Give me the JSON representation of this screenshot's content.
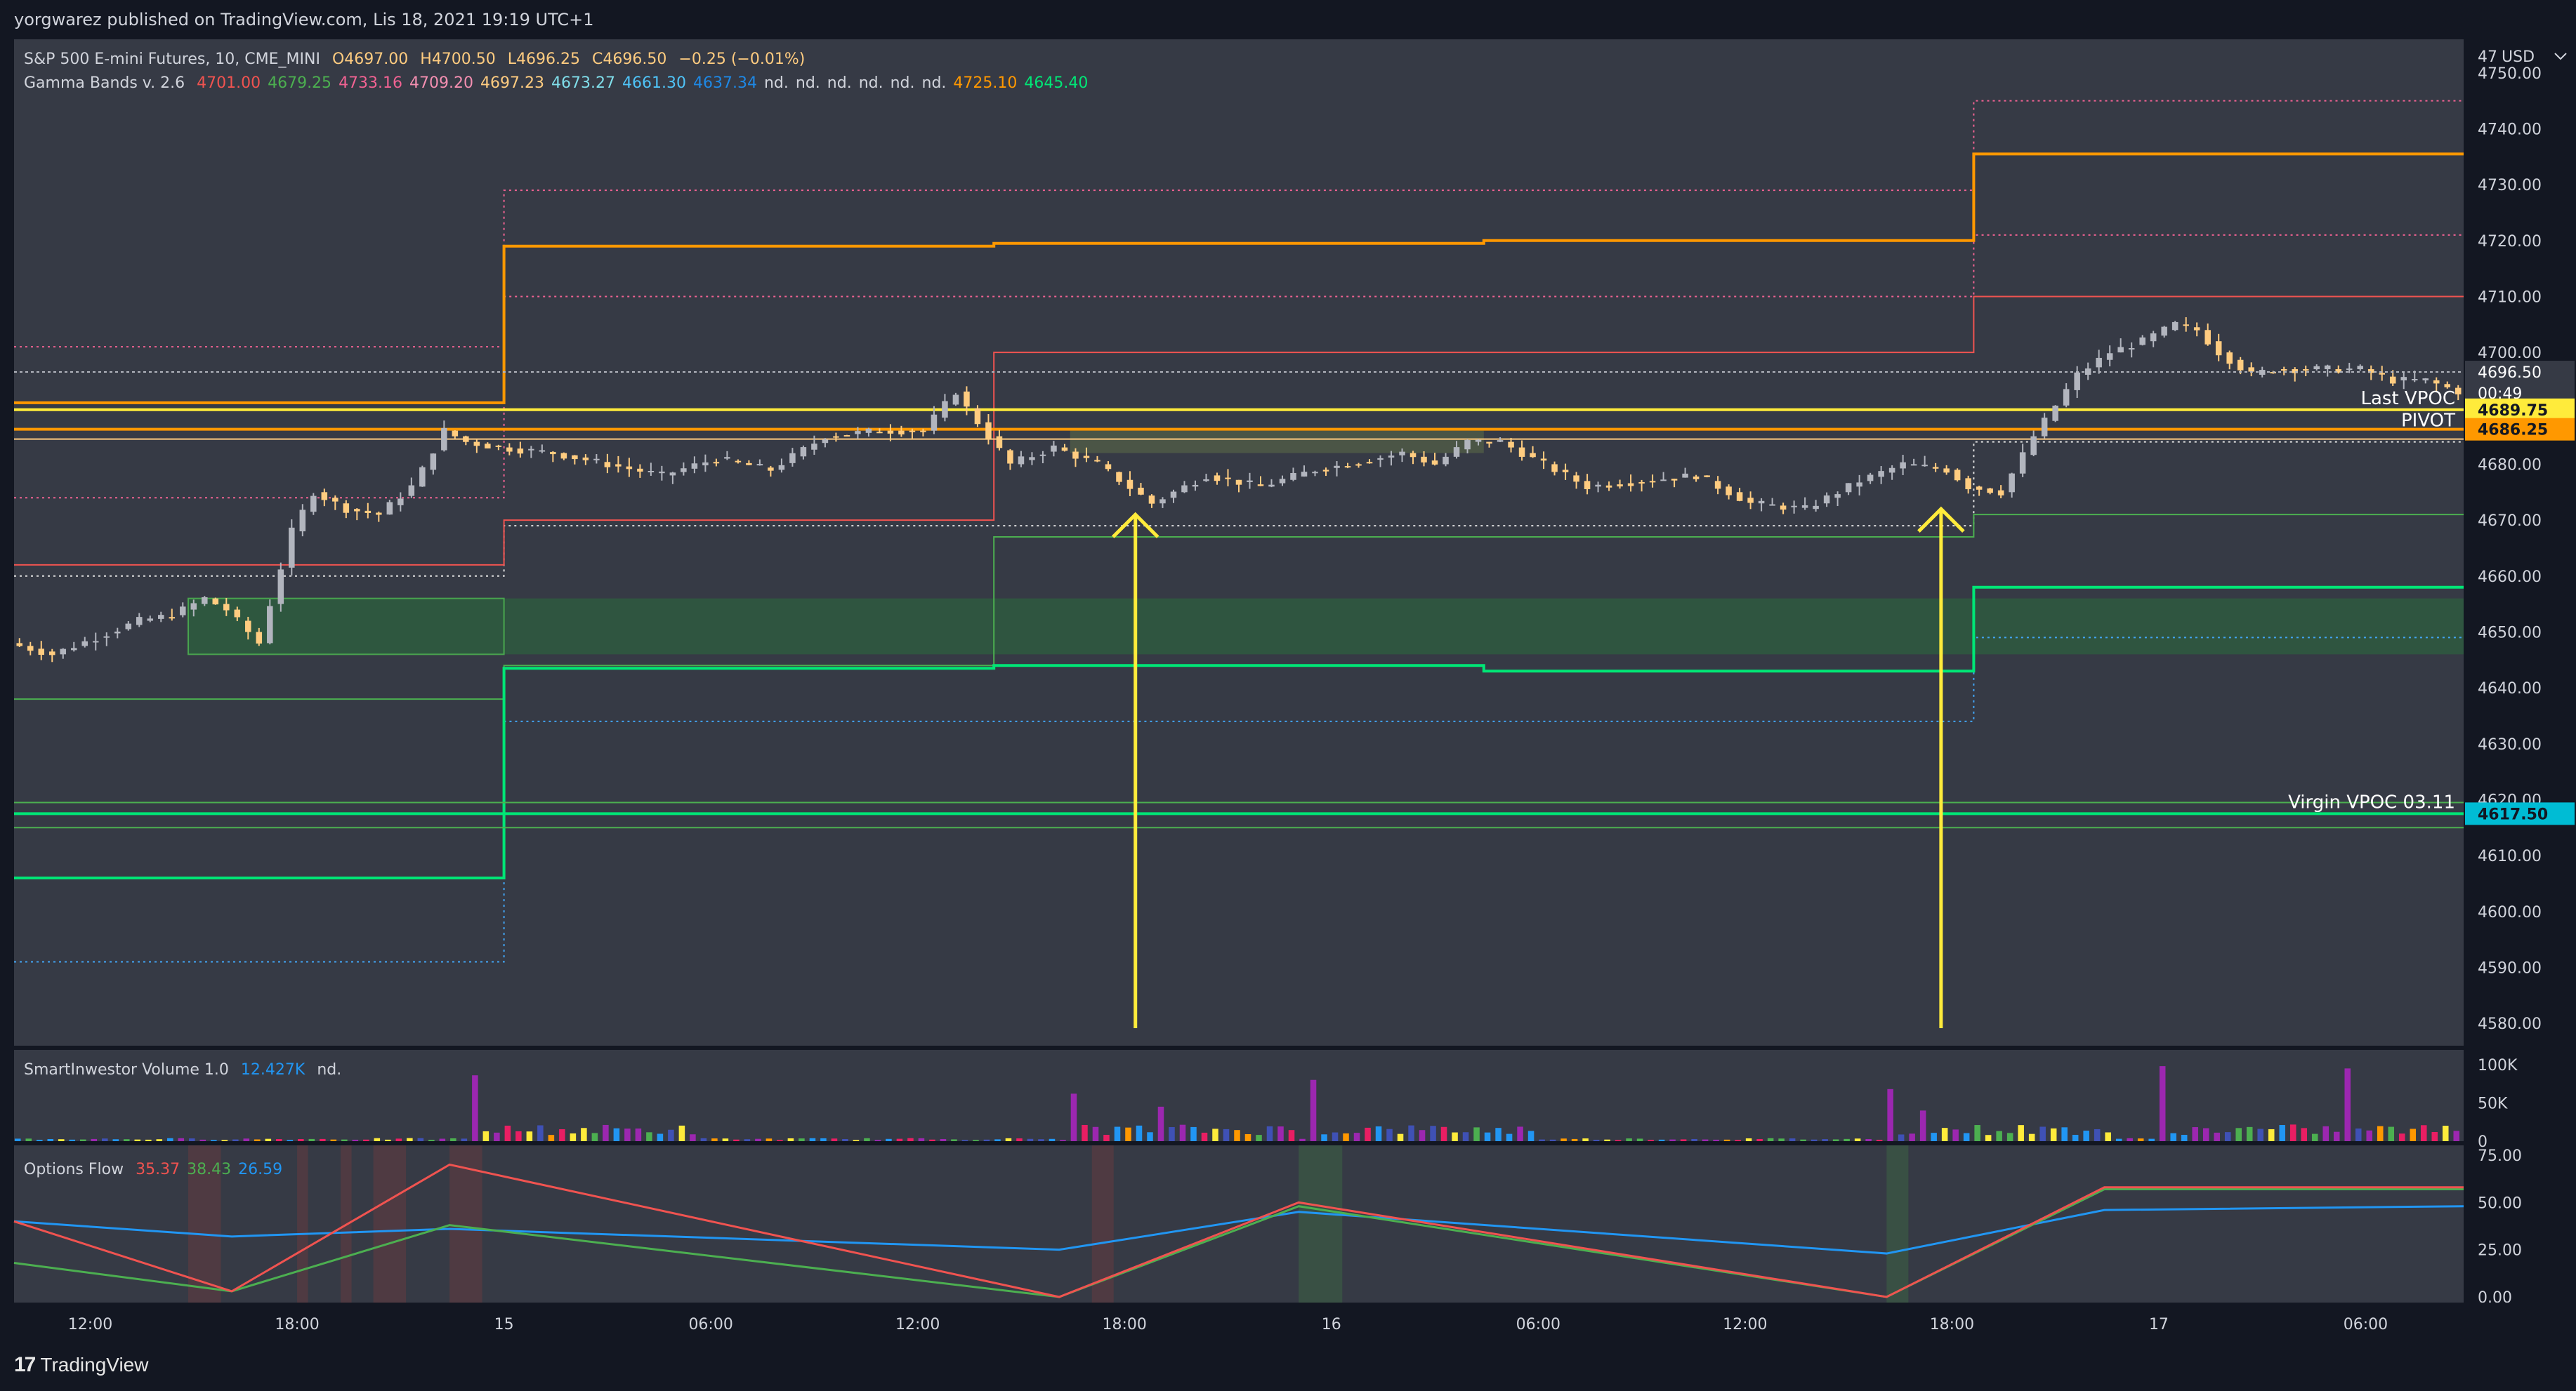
{
  "header": {
    "publisher_line": "yorgwarez published on TradingView.com, Lis 18, 2021 19:19 UTC+1"
  },
  "footer": {
    "logo_mark": "17",
    "logo_text": "TradingView"
  },
  "price_pane": {
    "symbol": "S&P 500 E-mini Futures, 10, CME_MINI",
    "ohlc": {
      "o_label": "O",
      "o": "4697.00",
      "h_label": "H",
      "h": "4700.50",
      "l_label": "L",
      "l": "4696.25",
      "c_label": "C",
      "c": "4696.50",
      "change": "−0.25 (−0.01%)"
    },
    "indicator": {
      "name": "Gamma Bands v. 2.6",
      "values": [
        {
          "text": "4701.00",
          "color": "#f05350"
        },
        {
          "text": "4679.25",
          "color": "#4caf50"
        },
        {
          "text": "4733.16",
          "color": "#f06292"
        },
        {
          "text": "4709.20",
          "color": "#f48fb1"
        },
        {
          "text": "4697.23",
          "color": "#ffcc80"
        },
        {
          "text": "4673.27",
          "color": "#80deea"
        },
        {
          "text": "4661.30",
          "color": "#4fc3f7"
        },
        {
          "text": "4637.34",
          "color": "#1e88e5"
        },
        {
          "text": "nd.",
          "color": "#d1d4dc"
        },
        {
          "text": "nd.",
          "color": "#d1d4dc"
        },
        {
          "text": "nd.",
          "color": "#d1d4dc"
        },
        {
          "text": "nd.",
          "color": "#d1d4dc"
        },
        {
          "text": "nd.",
          "color": "#d1d4dc"
        },
        {
          "text": "nd.",
          "color": "#d1d4dc"
        },
        {
          "text": "4725.10",
          "color": "#ff9800"
        },
        {
          "text": "4645.40",
          "color": "#00e676"
        }
      ]
    },
    "axis_currency": "USD",
    "price_labels": [
      "4750.00",
      "4740.00",
      "4730.00",
      "4720.00",
      "4710.00",
      "4700.00",
      "4680.00",
      "4670.00",
      "4660.00",
      "4650.00",
      "4640.00",
      "4630.00",
      "4620.00",
      "4610.00",
      "4600.00",
      "4590.00",
      "4580.00"
    ],
    "top_label": "47",
    "line_labels": {
      "last_vpoc": "Last VPOC",
      "pivot": "PIVOT",
      "virgin_vpoc": "Virgin VPOC 03.11"
    },
    "badges": {
      "last_price": "4696.50",
      "countdown": "00:49",
      "vpoc": "4689.75",
      "pivot": "4686.25",
      "virgin_vpoc": "4617.50"
    }
  },
  "volume_pane": {
    "name": "SmartInwestor Volume 1.0",
    "value": "12.427K",
    "extra": "nd.",
    "axis_labels": [
      "100K",
      "50K",
      "0"
    ]
  },
  "flow_pane": {
    "name": "Options Flow",
    "values": [
      {
        "text": "35.37",
        "color": "#f05350"
      },
      {
        "text": "38.43",
        "color": "#4caf50"
      },
      {
        "text": "26.59",
        "color": "#2196f3"
      }
    ],
    "axis_labels": [
      "75.00",
      "50.00",
      "25.00",
      "0.00"
    ]
  },
  "time_axis": [
    "12:00",
    "18:00",
    "15",
    "06:00",
    "12:00",
    "18:00",
    "16",
    "06:00",
    "12:00",
    "18:00",
    "17",
    "06:00"
  ],
  "colors": {
    "background": "#131722",
    "pane": "#363a45",
    "up_candle": "#b2b5be",
    "down_candle": "#ffcc80",
    "orange": "#ff9800",
    "green": "#00e676",
    "red": "#f05350",
    "yellow": "#ffeb3b",
    "cyan": "#00bcd4"
  },
  "chart_data": {
    "type": "line",
    "title": "S&P 500 E-mini Futures, 10, CME_MINI",
    "ylim": [
      4576,
      4756
    ],
    "close_path": [
      [
        0,
        4648
      ],
      [
        4,
        4646
      ],
      [
        8,
        4649
      ],
      [
        12,
        4652
      ],
      [
        15,
        4653
      ],
      [
        18,
        4656
      ],
      [
        20,
        4654
      ],
      [
        22,
        4650
      ],
      [
        23,
        4648
      ],
      [
        24,
        4655
      ],
      [
        26,
        4668
      ],
      [
        28,
        4675
      ],
      [
        31,
        4672
      ],
      [
        34,
        4671
      ],
      [
        37,
        4676
      ],
      [
        38,
        4679
      ],
      [
        40,
        4686
      ],
      [
        42,
        4684
      ],
      [
        45,
        4683
      ],
      [
        50,
        4682
      ],
      [
        55,
        4680
      ],
      [
        60,
        4678
      ],
      [
        65,
        4681
      ],
      [
        70,
        4679
      ],
      [
        75,
        4685
      ],
      [
        80,
        4686
      ],
      [
        84,
        4686
      ],
      [
        87,
        4693
      ],
      [
        88,
        4690
      ],
      [
        90,
        4685
      ],
      [
        92,
        4680
      ],
      [
        96,
        4683
      ],
      [
        100,
        4680
      ],
      [
        105,
        4673
      ],
      [
        110,
        4678
      ],
      [
        115,
        4676
      ],
      [
        120,
        4679
      ],
      [
        123,
        4680
      ],
      [
        128,
        4682
      ],
      [
        131,
        4680
      ],
      [
        134,
        4684
      ],
      [
        137,
        4684
      ],
      [
        140,
        4681
      ],
      [
        145,
        4676
      ],
      [
        150,
        4677
      ],
      [
        155,
        4678
      ],
      [
        160,
        4673
      ],
      [
        165,
        4672
      ],
      [
        170,
        4677
      ],
      [
        174,
        4680
      ],
      [
        178,
        4679
      ],
      [
        180,
        4676
      ],
      [
        183,
        4675
      ],
      [
        186,
        4685
      ],
      [
        190,
        4696
      ],
      [
        193,
        4700
      ],
      [
        196,
        4702
      ],
      [
        199,
        4705
      ],
      [
        201,
        4704
      ],
      [
        203,
        4700
      ],
      [
        206,
        4696
      ],
      [
        208,
        4697
      ],
      [
        212,
        4697
      ],
      [
        216,
        4697
      ],
      [
        219,
        4695
      ],
      [
        222,
        4695
      ],
      [
        225,
        4693
      ]
    ],
    "bands": {
      "segments": [
        [
          0,
          45
        ],
        [
          45,
          90
        ],
        [
          90,
          135
        ],
        [
          135,
          180
        ],
        [
          180,
          225
        ]
      ],
      "orange_upper": [
        4691,
        4719,
        4719.5,
        4720,
        4735.5
      ],
      "green_lower": [
        4606,
        4643.5,
        4644,
        4643,
        4658
      ],
      "red_upper": [
        4662,
        4670,
        4700,
        4700,
        4710
      ],
      "green_mid": [
        4638,
        4644,
        4667,
        4667,
        4671
      ],
      "pink_dotted": [
        4701,
        4729,
        4729,
        4729,
        4745
      ],
      "pink_dotted_2": [
        4674,
        4710,
        4710,
        4710,
        4721
      ],
      "white_dotted": [
        4660,
        4669,
        4669,
        4669,
        4684
      ],
      "blue_dotted": [
        4591,
        4634,
        4634,
        4634,
        4649
      ]
    },
    "levels": {
      "last_vpoc": 4689.75,
      "pivot": 4686.25,
      "virgin_vpoc": 4617.5,
      "pivot_2": 4684.5
    },
    "zones": [
      [
        4646,
        4656
      ],
      [
        4682,
        4686
      ]
    ],
    "arrows": [
      [
        103,
        4671
      ],
      [
        177,
        4672
      ]
    ],
    "volume_spikes": [
      [
        42,
        86
      ],
      [
        97,
        62
      ],
      [
        105,
        45
      ],
      [
        119,
        80
      ],
      [
        172,
        68
      ],
      [
        175,
        40
      ],
      [
        197,
        98
      ],
      [
        214,
        95
      ]
    ],
    "flow": {
      "reset_index": [
        0,
        20,
        96,
        172,
        225
      ],
      "red_levels": [
        [
          0,
          40
        ],
        [
          20,
          3
        ],
        [
          40,
          70
        ],
        [
          96,
          0
        ],
        [
          118,
          50
        ],
        [
          172,
          0
        ],
        [
          192,
          58
        ],
        [
          225,
          58
        ]
      ],
      "green_levels": [
        [
          0,
          18
        ],
        [
          20,
          3
        ],
        [
          40,
          38
        ],
        [
          96,
          0
        ],
        [
          118,
          48
        ],
        [
          172,
          0
        ],
        [
          192,
          57
        ],
        [
          225,
          57
        ]
      ],
      "blue_levels": [
        [
          0,
          40
        ],
        [
          20,
          32
        ],
        [
          40,
          36
        ],
        [
          96,
          25
        ],
        [
          118,
          45
        ],
        [
          172,
          23
        ],
        [
          192,
          46
        ],
        [
          225,
          48
        ]
      ]
    }
  }
}
